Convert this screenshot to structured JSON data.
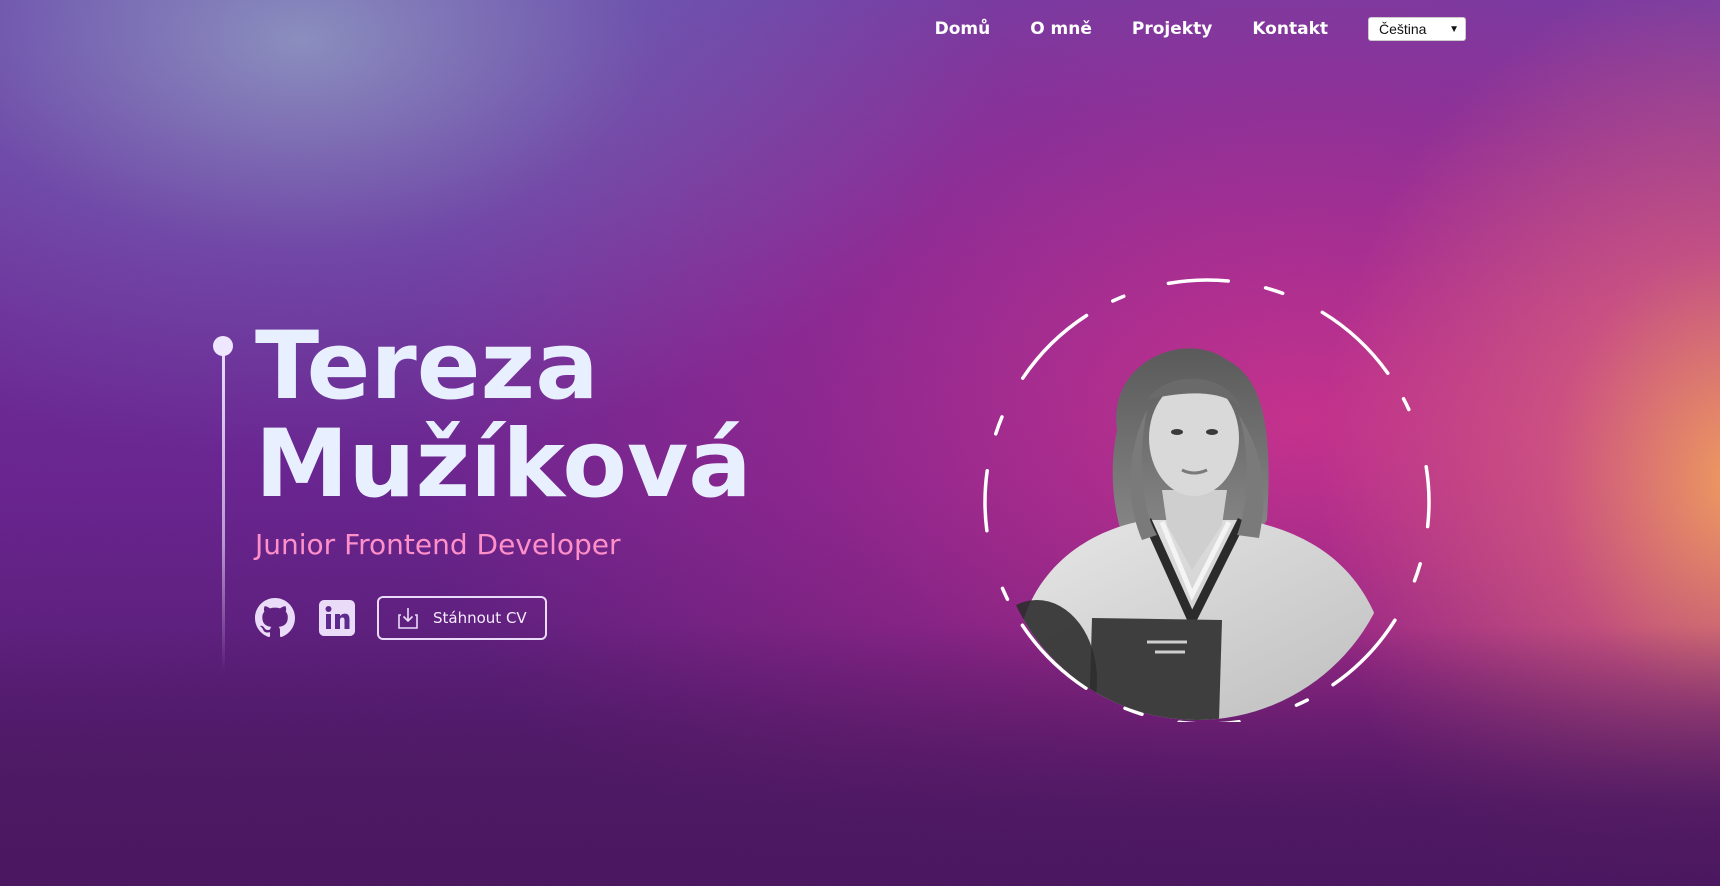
{
  "nav": {
    "items": [
      {
        "label": "Domů"
      },
      {
        "label": "O mně"
      },
      {
        "label": "Projekty"
      },
      {
        "label": "Kontakt"
      }
    ],
    "language": {
      "selected": "Čeština"
    }
  },
  "hero": {
    "first_name": "Tereza",
    "last_name": "Mužíková",
    "role": "Junior Frontend Developer",
    "social": [
      {
        "icon": "github-icon"
      },
      {
        "icon": "linkedin-icon"
      }
    ],
    "cv_button": {
      "label": "Stáhnout CV",
      "icon": "download-icon"
    }
  },
  "colors": {
    "name": "#e8f0ff",
    "role": "#ff8fc8",
    "accent_orange": "#f6a45c",
    "accent_pink": "#d6348c",
    "background_purple": "#4b1760"
  }
}
